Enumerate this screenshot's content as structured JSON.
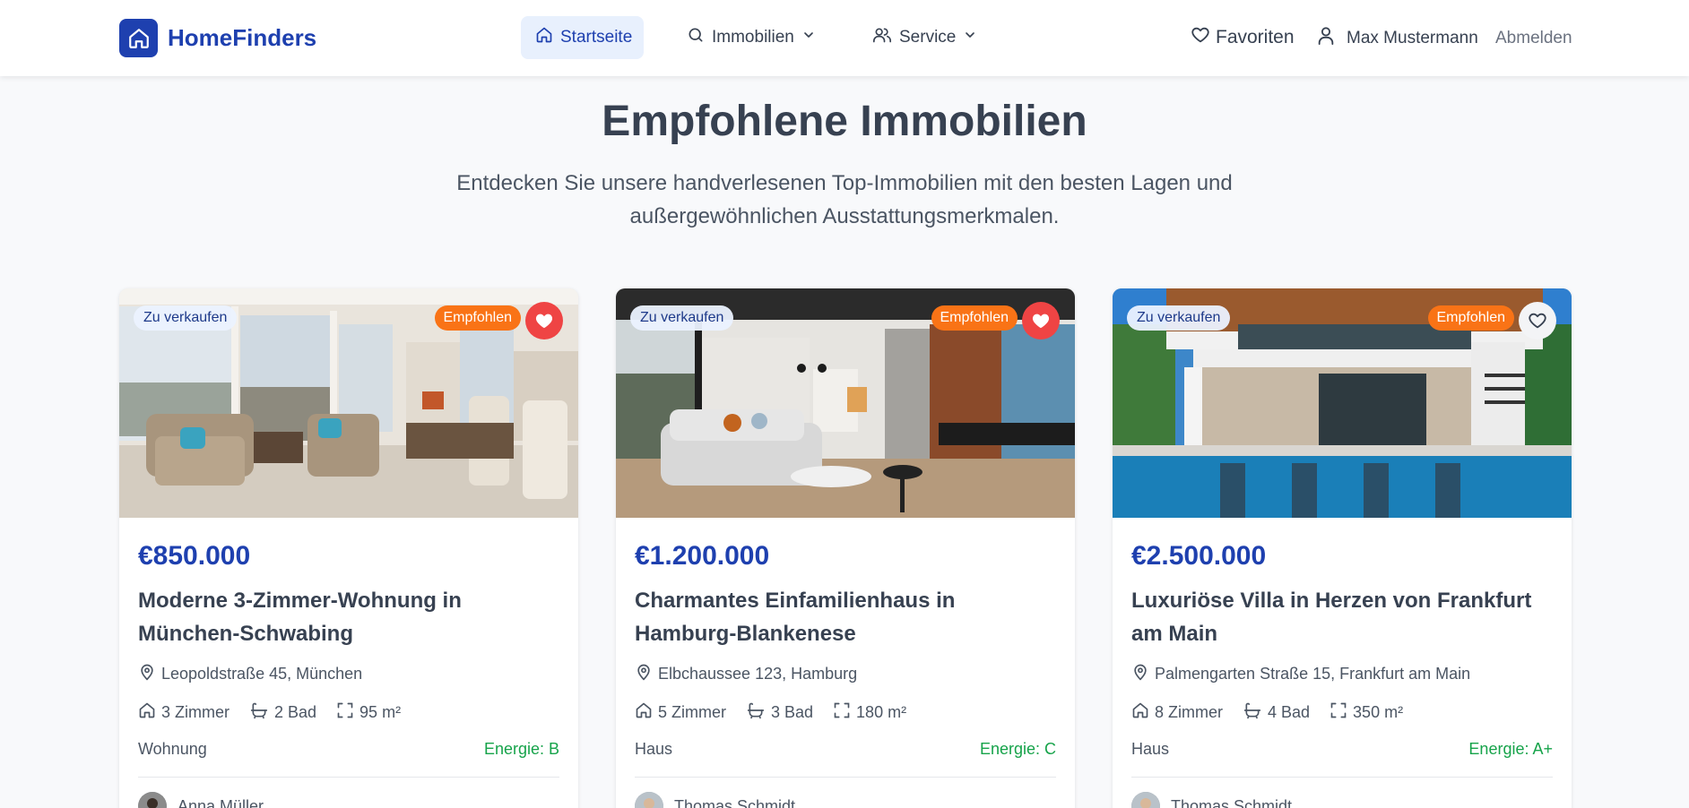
{
  "header": {
    "logo_text": "HomeFinders",
    "nav": {
      "home": "Startseite",
      "properties": "Immobilien",
      "service": "Service"
    },
    "favorites": "Favoriten",
    "user_name": "Max Mustermann",
    "logout": "Abmelden"
  },
  "hero": {
    "title": "Empfohlene Immobilien",
    "subtitle": "Entdecken Sie unsere handverlesenen Top-Immobilien mit den besten Lagen und außergewöhnlichen Ausstattungsmerkmalen."
  },
  "colors": {
    "primary": "#1e40af",
    "featured_badge": "#f97316",
    "favorite_active": "#ef4444",
    "energy": "#16a34a"
  },
  "listings": [
    {
      "status": "Zu verkaufen",
      "featured": "Empfohlen",
      "favorited": true,
      "price": "€850.000",
      "title": "Moderne 3-Zimmer-Wohnung in München-Schwabing",
      "address": "Leopoldstraße 45, München",
      "rooms": "3 Zimmer",
      "baths": "2 Bad",
      "area": "95 m²",
      "type": "Wohnung",
      "energy": "Energie: B",
      "agent": "Anna Müller"
    },
    {
      "status": "Zu verkaufen",
      "featured": "Empfohlen",
      "favorited": true,
      "price": "€1.200.000",
      "title": "Charmantes Einfamilienhaus in Hamburg-Blankenese",
      "address": "Elbchaussee 123, Hamburg",
      "rooms": "5 Zimmer",
      "baths": "3 Bad",
      "area": "180 m²",
      "type": "Haus",
      "energy": "Energie: C",
      "agent": "Thomas Schmidt"
    },
    {
      "status": "Zu verkaufen",
      "featured": "Empfohlen",
      "favorited": false,
      "price": "€2.500.000",
      "title": "Luxuriöse Villa in Herzen von Frankfurt am Main",
      "address": "Palmengarten Straße 15, Frankfurt am Main",
      "rooms": "8 Zimmer",
      "baths": "4 Bad",
      "area": "350 m²",
      "type": "Haus",
      "energy": "Energie: A+",
      "agent": "Thomas Schmidt"
    }
  ]
}
